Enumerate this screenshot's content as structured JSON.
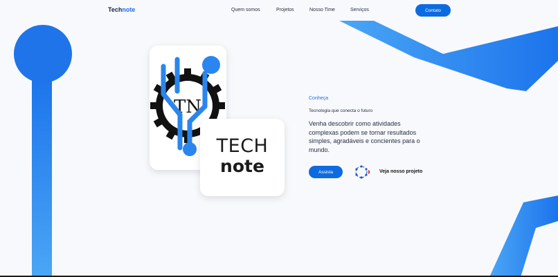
{
  "colors": {
    "primary": "#0d6be0",
    "deco_blue": "#2a8cf0",
    "background": "#f8f9fc"
  },
  "nav": {
    "brand_main": "Tech",
    "brand_accent": "note",
    "links": [
      "Quem somos",
      "Projetos",
      "Nosso Time",
      "Serviços"
    ],
    "contact_label": "Contato"
  },
  "hero": {
    "logo_badge": {
      "monogram": "TN",
      "icon": "gear-circuit-icon"
    },
    "logo_wordmark": {
      "line1": "TECH",
      "line2": "note"
    },
    "kicker": "Conheça",
    "tagline": "Tecnologia que conecta o futuro",
    "description": "Venha descobrir como atividades complexas podem se tornar resultados simples, agradáveis e concientes para o mundo.",
    "watch_label": "Assista",
    "play_icon": "play-icon",
    "project_link": "Veja nosso projeto"
  }
}
